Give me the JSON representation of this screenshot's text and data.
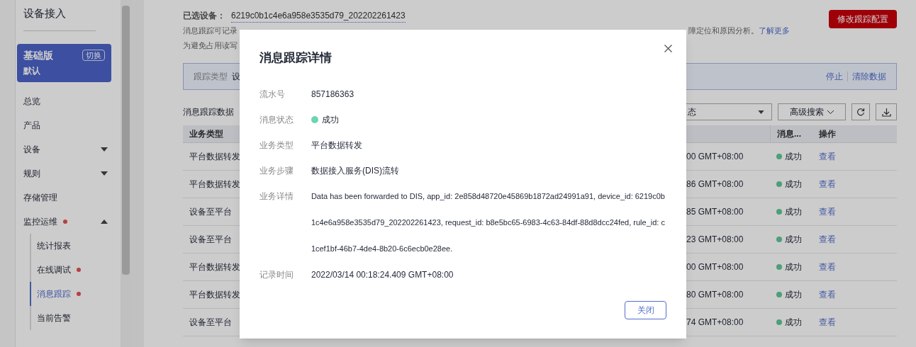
{
  "sidebar": {
    "title": "设备接入",
    "edition": {
      "name": "基础版",
      "tag": "切换",
      "subtitle": "默认"
    },
    "items": [
      {
        "label": "总览",
        "kind": "plain",
        "badge": false
      },
      {
        "label": "产品",
        "kind": "plain",
        "badge": false
      },
      {
        "label": "设备",
        "kind": "group",
        "badge": false,
        "expanded": false
      },
      {
        "label": "规则",
        "kind": "group",
        "badge": false,
        "expanded": false
      },
      {
        "label": "存储管理",
        "kind": "plain",
        "badge": false
      },
      {
        "label": "监控运维",
        "kind": "group",
        "badge": true,
        "expanded": true,
        "children": [
          {
            "label": "统计报表",
            "badge": false,
            "selected": false
          },
          {
            "label": "在线调试",
            "badge": true,
            "selected": false
          },
          {
            "label": "消息跟踪",
            "badge": true,
            "selected": true
          },
          {
            "label": "当前告警",
            "badge": false,
            "selected": false
          }
        ]
      }
    ]
  },
  "header": {
    "device_label": "已选设备：",
    "device_id": "6219c0b1c4e6a958e3535d79_202202261423",
    "description_start": "消息跟踪可记录",
    "description_end": "障定位和原因分析。",
    "learn_more": "了解更多",
    "notice_start": "为避免占用读写",
    "config_button": "修改跟踪配置"
  },
  "info_bar": {
    "label": "跟踪类型",
    "value": "设",
    "actions": [
      "停止",
      "清除数据"
    ]
  },
  "toolbar": {
    "title": "消息跟踪数据",
    "status_select": "态",
    "advanced_search": "高级搜索"
  },
  "table": {
    "columns": [
      "业务类型",
      "消息...",
      "操作"
    ],
    "rows": [
      {
        "type": "平台数据转发",
        "time": "00 GMT+08:00",
        "status": "成功",
        "action": "查看"
      },
      {
        "type": "平台数据转发",
        "time": "86 GMT+08:00",
        "status": "成功",
        "action": "查看"
      },
      {
        "type": "设备至平台",
        "time": "85 GMT+08:00",
        "status": "成功",
        "action": "查看"
      },
      {
        "type": "设备至平台",
        "time": "23 GMT+08:00",
        "status": "成功",
        "action": "查看"
      },
      {
        "type": "平台数据转发",
        "time": "00 GMT+08:00",
        "status": "成功",
        "action": "查看"
      },
      {
        "type": "平台数据转发",
        "time": "80 GMT+08:00",
        "status": "成功",
        "action": "查看"
      },
      {
        "type": "设备至平台",
        "time": "74 GMT+08:00",
        "status": "成功",
        "action": "查看"
      }
    ]
  },
  "dialog": {
    "title": "消息跟踪详情",
    "close_button": "关闭",
    "fields": [
      {
        "label": "流水号",
        "value": "857186363",
        "kind": "text"
      },
      {
        "label": "消息状态",
        "value": "成功",
        "kind": "status"
      },
      {
        "label": "业务类型",
        "value": "平台数据转发",
        "kind": "text"
      },
      {
        "label": "业务步骤",
        "value": "数据接入服务(DIS)流转",
        "kind": "text"
      },
      {
        "label": "业务详情",
        "value": "Data has been forwarded to DIS, app_id: 2e858d48720e45869b1872ad24991a91, device_id: 6219c0b1c4e6a958e3535d79_202202261423, request_id: b8e5bc65-6983-4c63-84df-88d8dcc24fed, rule_id: c1cef1bf-46b7-4de4-8b20-6c6ecb0e28ee.",
        "kind": "long"
      },
      {
        "label": "记录时间",
        "value": "2022/03/14 00:18:24.409 GMT+08:00",
        "kind": "text"
      }
    ]
  }
}
